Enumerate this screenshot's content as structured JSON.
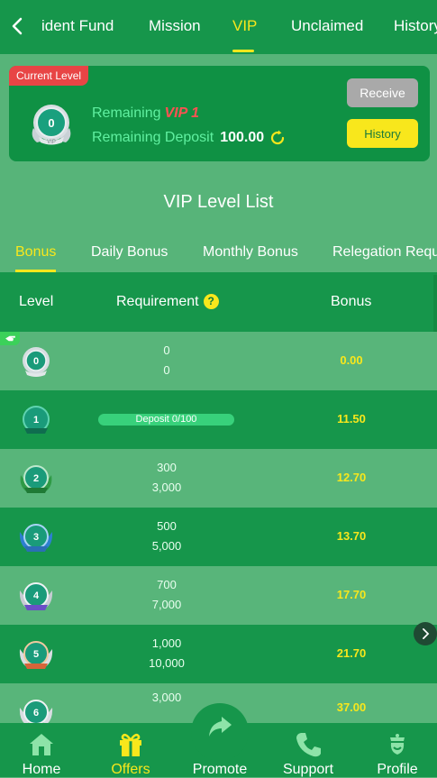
{
  "top_tabs": [
    "ident Fund",
    "Mission",
    "VIP",
    "Unclaimed",
    "History"
  ],
  "current_level": {
    "badge": "Current Level",
    "level": "0",
    "medal_text": "VIP",
    "remaining_label": "Remaining",
    "remaining_vip": "VIP 1",
    "remaining_deposit_label": "Remaining Deposit",
    "remaining_deposit_value": "100.00",
    "receive_label": "Receive",
    "history_label": "History"
  },
  "list_title": "VIP Level List",
  "sub_tabs": [
    "Bonus",
    "Daily Bonus",
    "Monthly Bonus",
    "Relegation Requ"
  ],
  "table": {
    "col_level": "Level",
    "col_requirement": "Requirement",
    "col_bonus": "Bonus",
    "rows": [
      {
        "level": "0",
        "req1": "0",
        "req2": "0",
        "bonus": "0.00"
      },
      {
        "level": "1",
        "progress": "Deposit 0/100",
        "bonus": "11.50"
      },
      {
        "level": "2",
        "req1": "300",
        "req2": "3,000",
        "bonus": "12.70"
      },
      {
        "level": "3",
        "req1": "500",
        "req2": "5,000",
        "bonus": "13.70"
      },
      {
        "level": "4",
        "req1": "700",
        "req2": "7,000",
        "bonus": "17.70"
      },
      {
        "level": "5",
        "req1": "1,000",
        "req2": "10,000",
        "bonus": "21.70"
      },
      {
        "level": "6",
        "req1": "3,000",
        "req2": "",
        "bonus": "37.00"
      }
    ]
  },
  "bottom_nav": [
    "Home",
    "Offers",
    "Promote",
    "Support",
    "Profile"
  ],
  "colors": {
    "accent": "#f8e71c",
    "green_dark": "#16964b",
    "green_light": "#58b57a",
    "badge_red": "#e84545"
  }
}
